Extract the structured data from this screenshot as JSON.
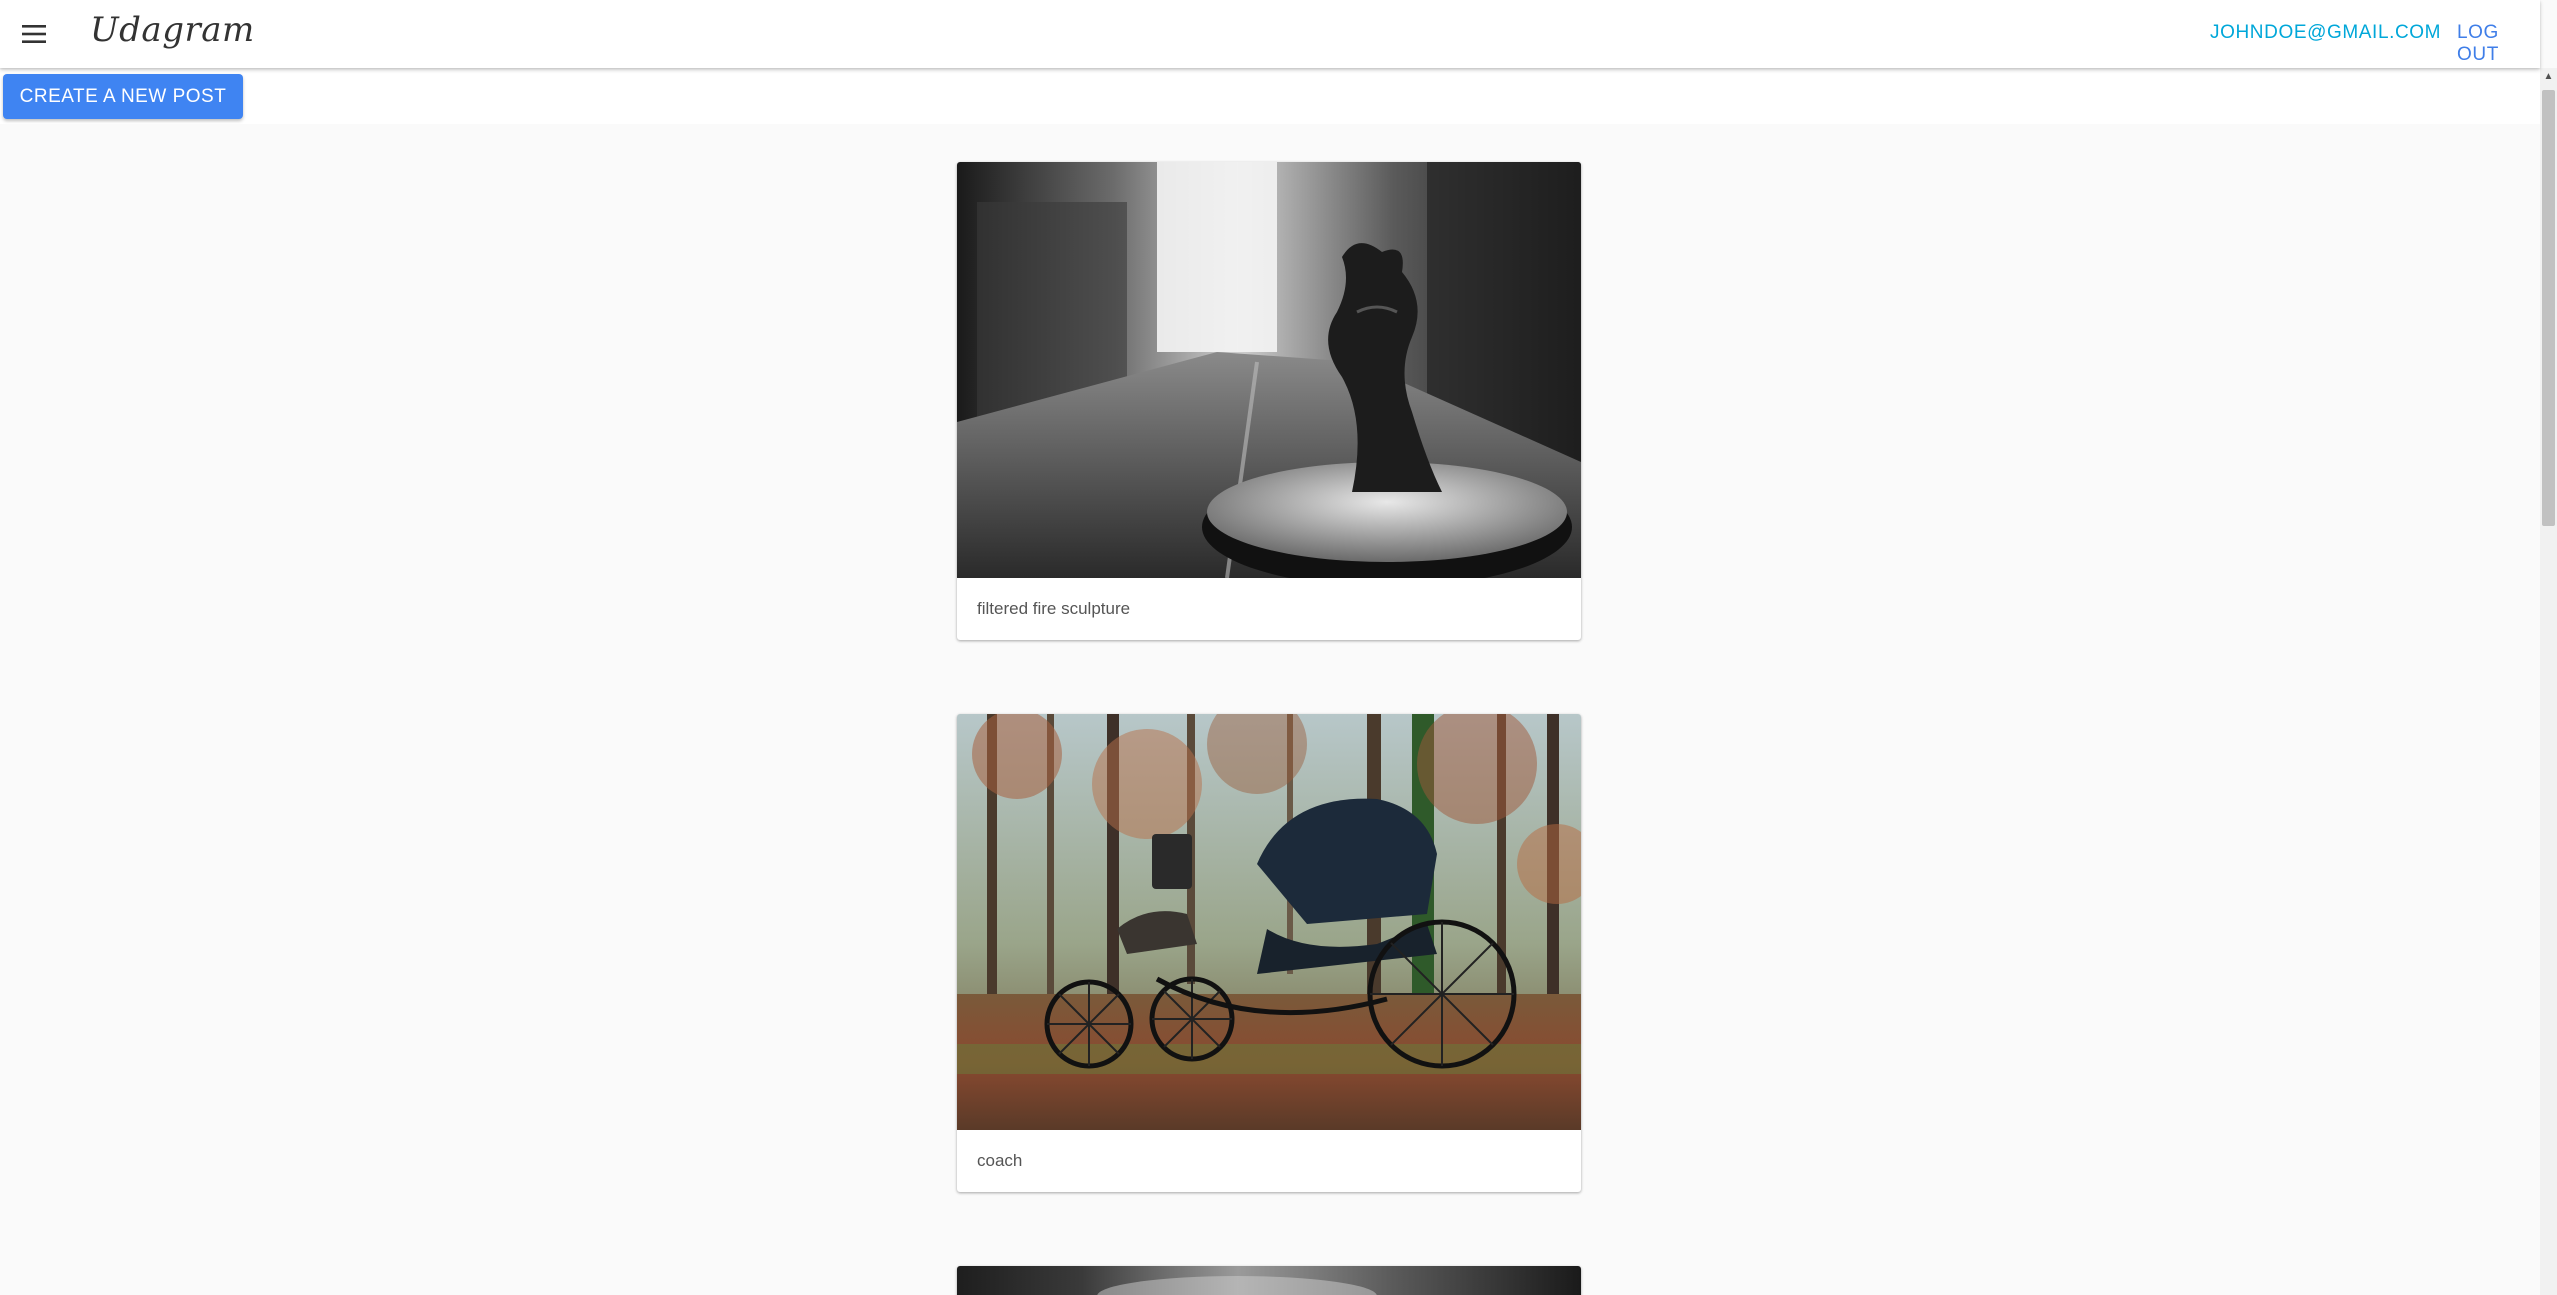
{
  "header": {
    "brand": "Udagram",
    "menu_icon": "hamburger-menu-icon",
    "user_email": "johndoe@gmail.com",
    "logout_label": "Log out"
  },
  "actions": {
    "create_post_label": "Create a new post"
  },
  "feed": {
    "posts": [
      {
        "caption": "filtered fire sculpture",
        "image": "black-and-white photo of a metal sculpture on a street"
      },
      {
        "caption": "coach",
        "image": "photo of a horse-drawn carriage in an autumn forest"
      },
      {
        "caption": "",
        "image": "partially visible black-and-white photo"
      }
    ]
  },
  "colors": {
    "accent_blue": "#3f84f2",
    "email_cyan": "#00a7d9",
    "logout_blue": "#3f7ee8",
    "background": "#fafafa"
  }
}
